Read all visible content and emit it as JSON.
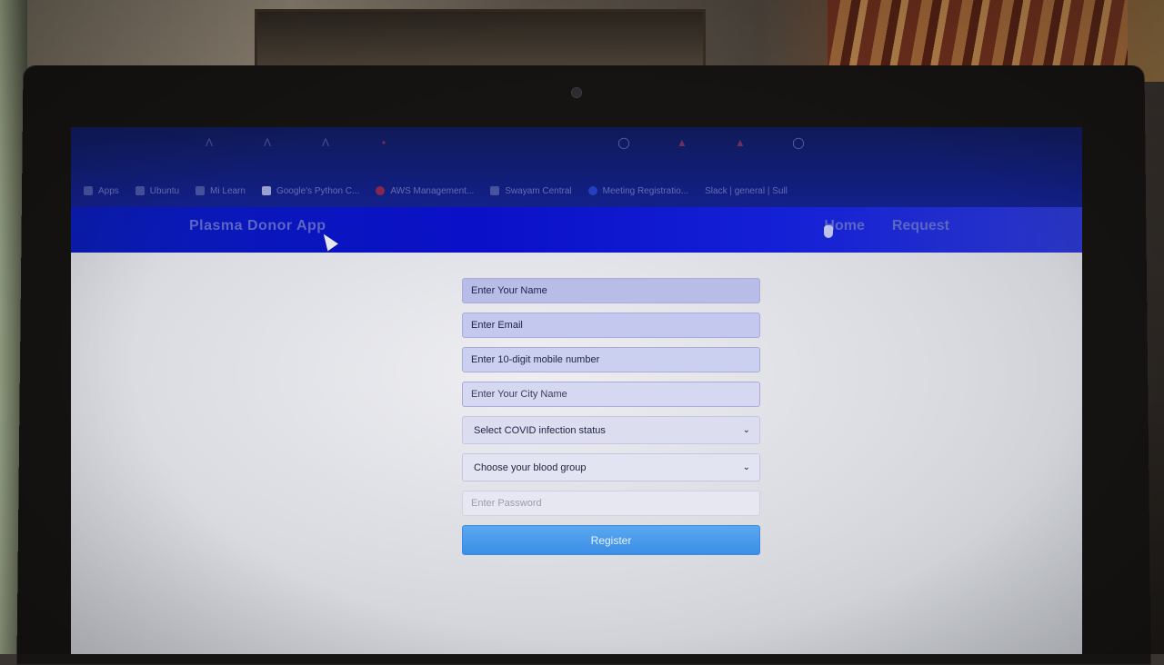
{
  "app": {
    "brand": "Plasma Donor App",
    "nav": [
      {
        "label": "Home"
      },
      {
        "label": "Request"
      }
    ]
  },
  "bookmarks": [
    {
      "label": "Apps"
    },
    {
      "label": "Ubuntu"
    },
    {
      "label": "Mi Learn"
    },
    {
      "label": "Google's Python C..."
    },
    {
      "label": "AWS Management..."
    },
    {
      "label": "Swayam Central"
    },
    {
      "label": "Meeting Registratio..."
    },
    {
      "label": "Slack | general | Sull"
    }
  ],
  "form": {
    "name_placeholder": "Enter Your Name",
    "email_placeholder": "Enter Email",
    "mobile_placeholder": "Enter 10-digit mobile number",
    "city_placeholder": "Enter Your City Name",
    "covid_select": "Select COVID infection status",
    "blood_select": "Choose your blood group",
    "password_placeholder": "Enter Password",
    "register_label": "Register"
  }
}
